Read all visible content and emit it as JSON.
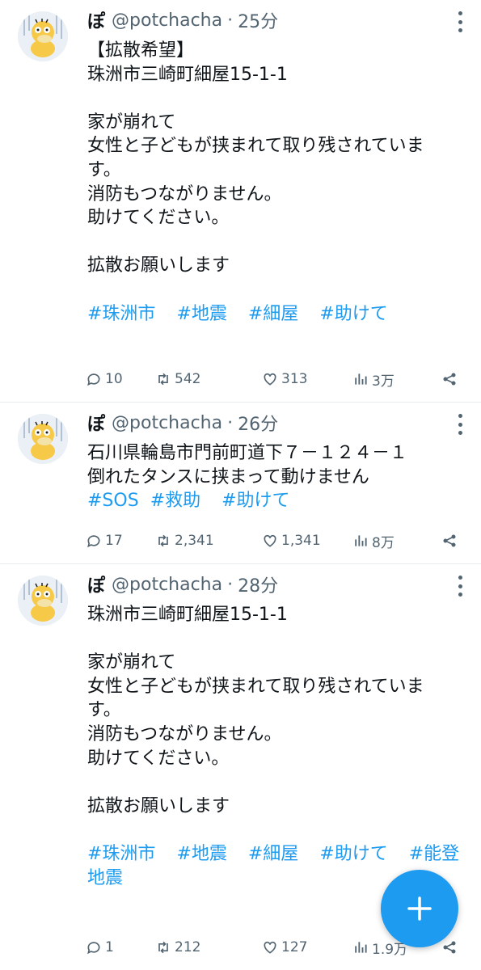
{
  "tweets": [
    {
      "name": "ぽ",
      "handle": "@potchacha",
      "dot": "·",
      "time": "25分",
      "lines": [
        "【拡散希望】",
        "珠洲市三崎町細屋15-1-1",
        "",
        "家が崩れて",
        "女性と子どもが挟まれて取り残されていま",
        "す。",
        "消防もつながりません。",
        "助けてください。",
        "",
        "拡散お願いします",
        ""
      ],
      "hashtags": [
        "#珠洲市",
        "#地震",
        "#細屋",
        "#助けて"
      ],
      "replies": "10",
      "retweets": "542",
      "likes": "313",
      "views": "3万"
    },
    {
      "name": "ぽ",
      "handle": "@potchacha",
      "dot": "·",
      "time": "26分",
      "lines": [
        "石川県輪島市門前町道下７－１２４－１",
        "倒れたタンスに挟まって動けません"
      ],
      "hashtags": [
        "#SOS",
        "#救助",
        "#助けて"
      ],
      "replies": "17",
      "retweets": "2,341",
      "likes": "1,341",
      "views": "8万"
    },
    {
      "name": "ぽ",
      "handle": "@potchacha",
      "dot": "·",
      "time": "28分",
      "lines": [
        "珠洲市三崎町細屋15-1-1",
        "",
        "家が崩れて",
        "女性と子どもが挟まれて取り残されていま",
        "す。",
        "消防もつながりません。",
        "助けてください。",
        "",
        "拡散お願いします",
        ""
      ],
      "hashtags": [
        "#珠洲市",
        "#地震",
        "#細屋",
        "#助けて",
        "#能登"
      ],
      "hashtag_wrap": "地震",
      "replies": "1",
      "retweets": "212",
      "likes": "127",
      "views": "1.9万"
    }
  ],
  "icons": {
    "avatar": "psyduck-avatar-icon",
    "more": "more-options-icon",
    "reply": "reply-icon",
    "retweet": "retweet-icon",
    "like": "heart-icon",
    "views": "views-chart-icon",
    "share": "share-icon",
    "compose": "plus-icon"
  },
  "colors": {
    "accent": "#1d9bf0",
    "text": "#0f1419",
    "muted": "#536471",
    "divider": "#e6ecf0"
  }
}
